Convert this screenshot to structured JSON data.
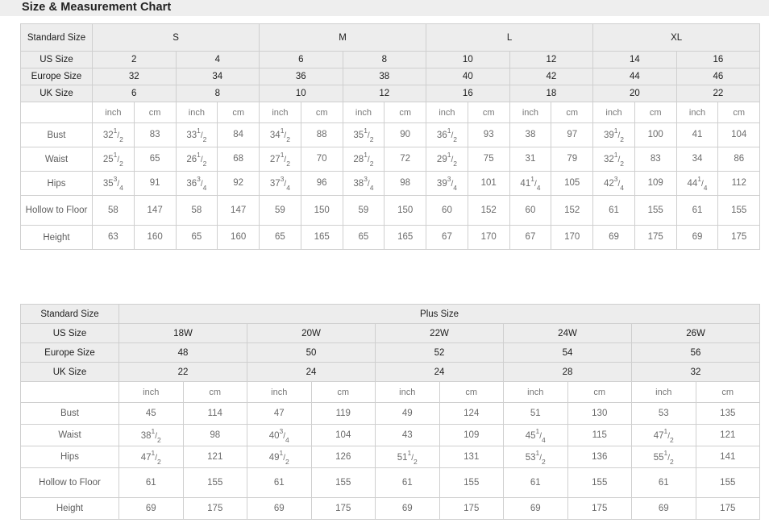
{
  "page": {
    "title": "Size & Measurement Chart"
  },
  "standard_table": {
    "name": "Standard Size Chart",
    "corner_label": "Standard Size",
    "group_headers": [
      {
        "label": "S",
        "span": 4
      },
      {
        "label": "M",
        "span": 4
      },
      {
        "label": "L",
        "span": 4
      },
      {
        "label": "XL",
        "span": 4
      }
    ],
    "size_rows": [
      {
        "label": "US Size",
        "values": [
          "2",
          "4",
          "6",
          "8",
          "10",
          "12",
          "14",
          "16"
        ]
      },
      {
        "label": "Europe Size",
        "values": [
          "32",
          "34",
          "36",
          "38",
          "40",
          "42",
          "44",
          "46"
        ]
      },
      {
        "label": "UK Size",
        "values": [
          "6",
          "8",
          "10",
          "12",
          "16",
          "18",
          "20",
          "22"
        ]
      }
    ],
    "unit_row": {
      "label": "",
      "units": [
        "inch",
        "cm",
        "inch",
        "cm",
        "inch",
        "cm",
        "inch",
        "cm",
        "inch",
        "cm",
        "inch",
        "cm",
        "inch",
        "cm",
        "inch",
        "cm"
      ]
    },
    "measurement_rows": [
      {
        "label": "Bust",
        "values": [
          {
            "whole": "32",
            "num": "1",
            "den": "2"
          },
          {
            "whole": "83"
          },
          {
            "whole": "33",
            "num": "1",
            "den": "2"
          },
          {
            "whole": "84"
          },
          {
            "whole": "34",
            "num": "1",
            "den": "2"
          },
          {
            "whole": "88"
          },
          {
            "whole": "35",
            "num": "1",
            "den": "2"
          },
          {
            "whole": "90"
          },
          {
            "whole": "36",
            "num": "1",
            "den": "2"
          },
          {
            "whole": "93"
          },
          {
            "whole": "38"
          },
          {
            "whole": "97"
          },
          {
            "whole": "39",
            "num": "1",
            "den": "2"
          },
          {
            "whole": "100"
          },
          {
            "whole": "41"
          },
          {
            "whole": "104"
          }
        ]
      },
      {
        "label": "Waist",
        "values": [
          {
            "whole": "25",
            "num": "1",
            "den": "2"
          },
          {
            "whole": "65"
          },
          {
            "whole": "26",
            "num": "1",
            "den": "2"
          },
          {
            "whole": "68"
          },
          {
            "whole": "27",
            "num": "1",
            "den": "2"
          },
          {
            "whole": "70"
          },
          {
            "whole": "28",
            "num": "1",
            "den": "2"
          },
          {
            "whole": "72"
          },
          {
            "whole": "29",
            "num": "1",
            "den": "2"
          },
          {
            "whole": "75"
          },
          {
            "whole": "31"
          },
          {
            "whole": "79"
          },
          {
            "whole": "32",
            "num": "1",
            "den": "2"
          },
          {
            "whole": "83"
          },
          {
            "whole": "34"
          },
          {
            "whole": "86"
          }
        ]
      },
      {
        "label": "Hips",
        "values": [
          {
            "whole": "35",
            "num": "3",
            "den": "4"
          },
          {
            "whole": "91"
          },
          {
            "whole": "36",
            "num": "3",
            "den": "4"
          },
          {
            "whole": "92"
          },
          {
            "whole": "37",
            "num": "3",
            "den": "4"
          },
          {
            "whole": "96"
          },
          {
            "whole": "38",
            "num": "3",
            "den": "4"
          },
          {
            "whole": "98"
          },
          {
            "whole": "39",
            "num": "3",
            "den": "4"
          },
          {
            "whole": "101"
          },
          {
            "whole": "41",
            "num": "1",
            "den": "4"
          },
          {
            "whole": "105"
          },
          {
            "whole": "42",
            "num": "3",
            "den": "4"
          },
          {
            "whole": "109"
          },
          {
            "whole": "44",
            "num": "1",
            "den": "4"
          },
          {
            "whole": "112"
          }
        ]
      },
      {
        "label": "Hollow to Floor",
        "values": [
          {
            "whole": "58"
          },
          {
            "whole": "147"
          },
          {
            "whole": "58"
          },
          {
            "whole": "147"
          },
          {
            "whole": "59"
          },
          {
            "whole": "150"
          },
          {
            "whole": "59"
          },
          {
            "whole": "150"
          },
          {
            "whole": "60"
          },
          {
            "whole": "152"
          },
          {
            "whole": "60"
          },
          {
            "whole": "152"
          },
          {
            "whole": "61"
          },
          {
            "whole": "155"
          },
          {
            "whole": "61"
          },
          {
            "whole": "155"
          }
        ]
      },
      {
        "label": "Height",
        "values": [
          {
            "whole": "63"
          },
          {
            "whole": "160"
          },
          {
            "whole": "65"
          },
          {
            "whole": "160"
          },
          {
            "whole": "65"
          },
          {
            "whole": "165"
          },
          {
            "whole": "65"
          },
          {
            "whole": "165"
          },
          {
            "whole": "67"
          },
          {
            "whole": "170"
          },
          {
            "whole": "67"
          },
          {
            "whole": "170"
          },
          {
            "whole": "69"
          },
          {
            "whole": "175"
          },
          {
            "whole": "69"
          },
          {
            "whole": "175"
          }
        ]
      }
    ]
  },
  "plus_table": {
    "name": "Plus Size Chart",
    "corner_label": "Standard Size",
    "group_header": "Plus Size",
    "size_rows": [
      {
        "label": "US Size",
        "values": [
          "18W",
          "20W",
          "22W",
          "24W",
          "26W"
        ]
      },
      {
        "label": "Europe Size",
        "values": [
          "48",
          "50",
          "52",
          "54",
          "56"
        ]
      },
      {
        "label": "UK Size",
        "values": [
          "22",
          "24",
          "24",
          "28",
          "32"
        ]
      }
    ],
    "unit_row": {
      "label": "",
      "units": [
        "inch",
        "cm",
        "inch",
        "cm",
        "inch",
        "cm",
        "inch",
        "cm",
        "inch",
        "cm"
      ]
    },
    "measurement_rows": [
      {
        "label": "Bust",
        "values": [
          {
            "whole": "45"
          },
          {
            "whole": "114"
          },
          {
            "whole": "47"
          },
          {
            "whole": "119"
          },
          {
            "whole": "49"
          },
          {
            "whole": "124"
          },
          {
            "whole": "51"
          },
          {
            "whole": "130"
          },
          {
            "whole": "53"
          },
          {
            "whole": "135"
          }
        ]
      },
      {
        "label": "Waist",
        "values": [
          {
            "whole": "38",
            "num": "1",
            "den": "2"
          },
          {
            "whole": "98"
          },
          {
            "whole": "40",
            "num": "3",
            "den": "4"
          },
          {
            "whole": "104"
          },
          {
            "whole": "43"
          },
          {
            "whole": "109"
          },
          {
            "whole": "45",
            "num": "1",
            "den": "4"
          },
          {
            "whole": "115"
          },
          {
            "whole": "47",
            "num": "1",
            "den": "2"
          },
          {
            "whole": "121"
          }
        ]
      },
      {
        "label": "Hips",
        "values": [
          {
            "whole": "47",
            "num": "1",
            "den": "2"
          },
          {
            "whole": "121"
          },
          {
            "whole": "49",
            "num": "1",
            "den": "2"
          },
          {
            "whole": "126"
          },
          {
            "whole": "51",
            "num": "1",
            "den": "2"
          },
          {
            "whole": "131"
          },
          {
            "whole": "53",
            "num": "1",
            "den": "2"
          },
          {
            "whole": "136"
          },
          {
            "whole": "55",
            "num": "1",
            "den": "2"
          },
          {
            "whole": "141"
          }
        ]
      },
      {
        "label": "Hollow to Floor",
        "values": [
          {
            "whole": "61"
          },
          {
            "whole": "155"
          },
          {
            "whole": "61"
          },
          {
            "whole": "155"
          },
          {
            "whole": "61"
          },
          {
            "whole": "155"
          },
          {
            "whole": "61"
          },
          {
            "whole": "155"
          },
          {
            "whole": "61"
          },
          {
            "whole": "155"
          }
        ]
      },
      {
        "label": "Height",
        "values": [
          {
            "whole": "69"
          },
          {
            "whole": "175"
          },
          {
            "whole": "69"
          },
          {
            "whole": "175"
          },
          {
            "whole": "69"
          },
          {
            "whole": "175"
          },
          {
            "whole": "69"
          },
          {
            "whole": "175"
          },
          {
            "whole": "69"
          },
          {
            "whole": "175"
          }
        ]
      }
    ]
  },
  "colors": {
    "header_bg": "#ededed",
    "title_bg": "#eeeeee",
    "border": "#cfcfcf",
    "header_text": "#1c1c1c",
    "data_text": "#6b6b6b"
  }
}
